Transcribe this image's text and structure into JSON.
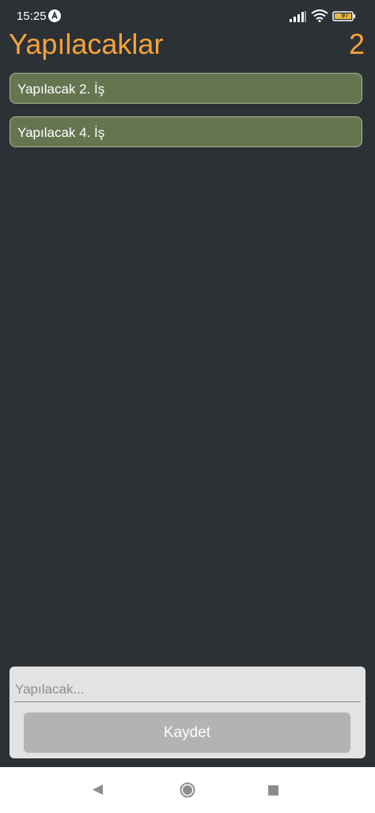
{
  "status_bar": {
    "time": "15:25",
    "battery_level": "97"
  },
  "header": {
    "title": "Yapılacaklar",
    "count": "2"
  },
  "todos": [
    {
      "label": "Yapılacak 2. İş"
    },
    {
      "label": "Yapılacak 4. İş"
    }
  ],
  "form": {
    "input_value": "",
    "input_placeholder": "Yapılacak...",
    "save_label": "Kaydet"
  },
  "colors": {
    "background": "#2c3136",
    "accent": "#f7a23b",
    "todo_item": "#657550",
    "button": "#b3b3b3"
  }
}
